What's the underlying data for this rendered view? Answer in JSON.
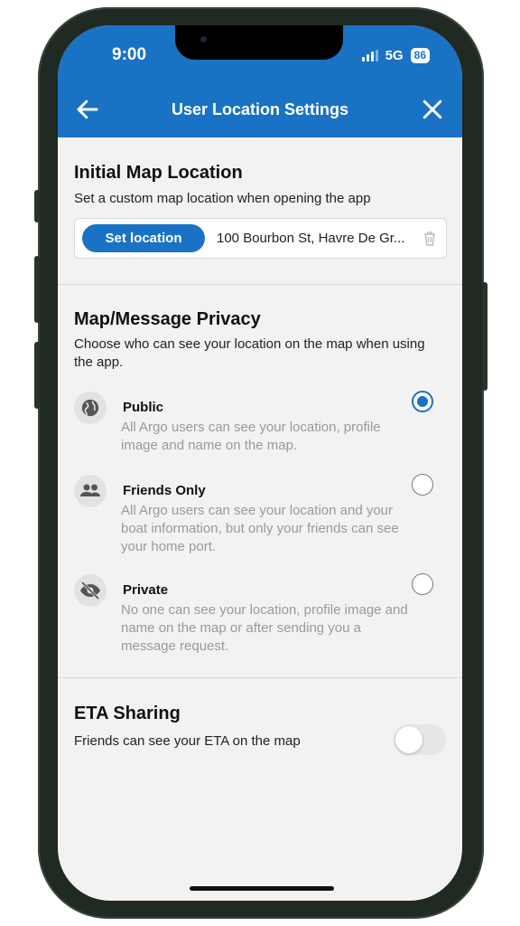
{
  "status_bar": {
    "time": "9:00",
    "network": "5G",
    "battery": "86"
  },
  "header": {
    "title": "User Location Settings",
    "accent_color": "#1a72c4"
  },
  "initial_map_location": {
    "title": "Initial Map Location",
    "description": "Set a custom map location when opening the app",
    "button_label": "Set location",
    "location_value": "100 Bourbon St, Havre De Gr..."
  },
  "privacy": {
    "title": "Map/Message Privacy",
    "description": "Choose who can see your location on the map when using the app.",
    "selected": "public",
    "options": [
      {
        "id": "public",
        "label": "Public",
        "description": "All Argo users can see your location, profile image and name on the map.",
        "icon": "globe-icon"
      },
      {
        "id": "friends",
        "label": "Friends Only",
        "description": "All Argo users can see your location and your boat information, but only your friends can see your home port.",
        "icon": "people-icon"
      },
      {
        "id": "private",
        "label": "Private",
        "description": "No one can see your location, profile image and name on the map or after sending you a message request.",
        "icon": "eye-off-icon"
      }
    ]
  },
  "eta_sharing": {
    "title": "ETA Sharing",
    "description": "Friends can see your ETA on the map",
    "enabled": false
  }
}
